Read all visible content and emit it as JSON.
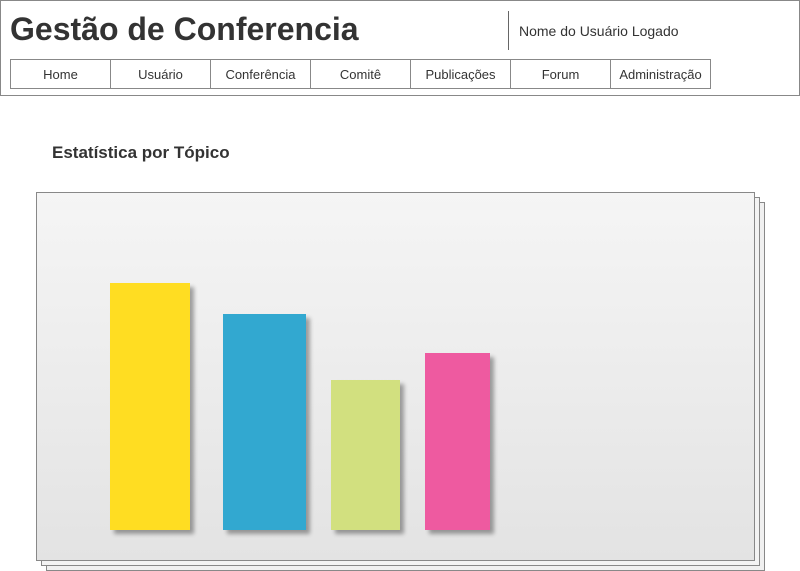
{
  "header": {
    "title": "Gestão de Conferencia",
    "user_name": "Nome do Usuário Logado"
  },
  "nav": {
    "items": [
      {
        "label": "Home"
      },
      {
        "label": "Usuário"
      },
      {
        "label": "Conferência"
      },
      {
        "label": "Comitê"
      },
      {
        "label": "Publicações"
      },
      {
        "label": "Forum"
      },
      {
        "label": "Administração"
      }
    ]
  },
  "main": {
    "section_title": "Estatística por Tópico"
  },
  "chart_data": {
    "type": "bar",
    "title": "",
    "xlabel": "",
    "ylabel": "",
    "categories": [
      "",
      "",
      "",
      ""
    ],
    "values": [
      247,
      216,
      150,
      177
    ],
    "colors": [
      "#ffdd22",
      "#33a8d0",
      "#d2e07f",
      "#ee5aa0"
    ],
    "grid": false,
    "legend": "none"
  }
}
